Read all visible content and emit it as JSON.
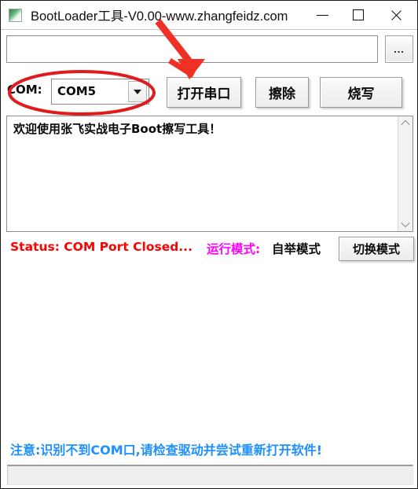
{
  "window": {
    "title": "BootLoader工具-V0.00-www.zhangfeidz.com",
    "icon": "app-logo-icon",
    "controls": {
      "minimize": "minimize-icon",
      "maximize": "maximize-icon",
      "close": "close-icon"
    }
  },
  "file_row": {
    "path_value": "",
    "path_placeholder": "",
    "browse_label": "..."
  },
  "toolbar": {
    "com_label": "COM:",
    "com_selected": "COM5",
    "com_options": [
      "COM5"
    ],
    "dropdown_icon": "chevron-down-icon",
    "open_com_label": "打开串口",
    "erase_label": "擦除",
    "flash_label": "烧写"
  },
  "log": {
    "content": "欢迎使用张飞实战电子Boot擦写工具！",
    "scroll_up_icon": "chevron-up-icon",
    "scroll_down_icon": "chevron-down-icon"
  },
  "status": {
    "status_text": "Status: COM Port Closed...",
    "status_color": "#FF0000",
    "run_mode_label": "运行模式:",
    "run_mode_label_color": "#FF00FF",
    "run_mode_value": "自举模式",
    "switch_mode_label": "切换模式"
  },
  "footer": {
    "warning_text": "注意:识别不到COM口,请检查驱动并尝试重新打开软件!",
    "warning_color": "#1E90FF"
  },
  "annotations": {
    "arrow_color": "#EE3124",
    "ellipse_color": "#E01B1B",
    "arrow_name": "red-arrow-annotation",
    "ellipse_name": "red-ellipse-annotation"
  }
}
